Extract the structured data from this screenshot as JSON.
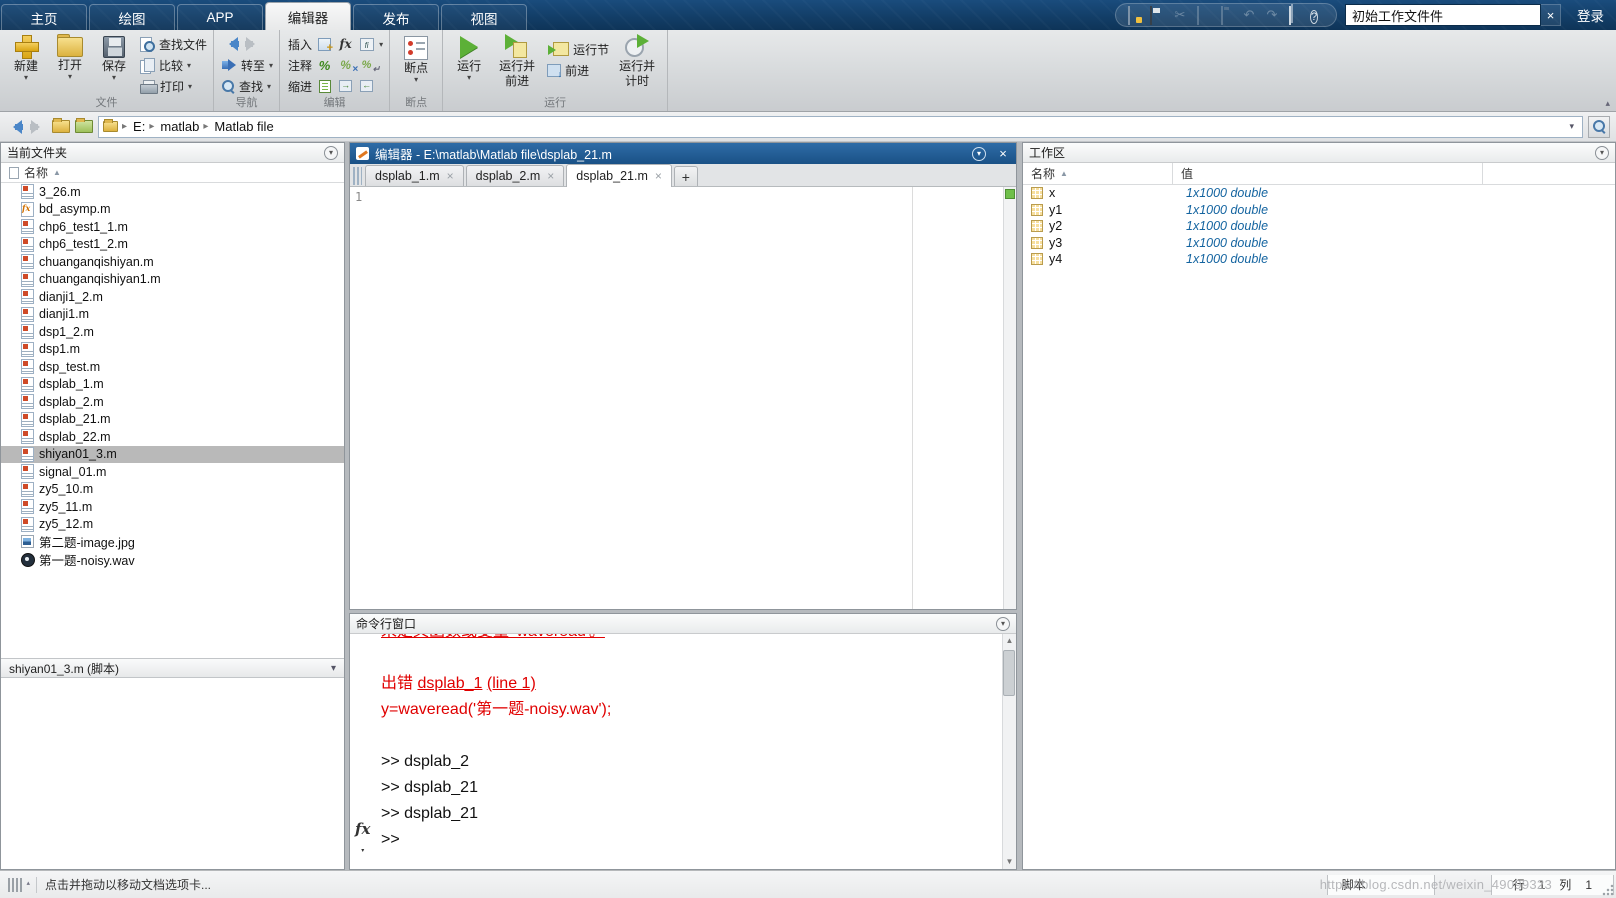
{
  "icons": {
    "dropdown": "▾",
    "sort_asc": "▲",
    "close": "×",
    "new_tab": "+",
    "scroll_up": "▲",
    "scroll_down": "▼",
    "undo": "↶",
    "redo": "↷",
    "cut": "✂",
    "help": "?",
    "collapse": "▴",
    "fx": "fx",
    "prompt": ">>"
  },
  "titlebar": {
    "tabs": [
      {
        "label": "主页"
      },
      {
        "label": "绘图"
      },
      {
        "label": "APP"
      },
      {
        "label": "编辑器",
        "active": true
      },
      {
        "label": "发布"
      },
      {
        "label": "视图"
      }
    ],
    "search_value": "初始工作文件件",
    "login_label": "登录"
  },
  "ribbon": {
    "file_group": {
      "label": "文件",
      "new": "新建",
      "open": "打开",
      "save": "保存",
      "find_files": "查找文件",
      "compare": "比较",
      "print": "打印"
    },
    "nav_group": {
      "label": "导航",
      "goto": "转至",
      "find": "查找"
    },
    "edit_group": {
      "label": "编辑",
      "insert": "插入",
      "comment": "注释",
      "indent": "缩进"
    },
    "bp_group": {
      "label": "断点",
      "breakpoints": "断点"
    },
    "run_group": {
      "label": "运行",
      "run": "运行",
      "run_advance_1": "运行并",
      "run_advance_2": "前进",
      "run_section": "运行节",
      "advance": "前进",
      "run_time_1": "运行并",
      "run_time_2": "计时"
    }
  },
  "address_bar": {
    "crumbs": [
      {
        "label": "E:"
      },
      {
        "label": "matlab"
      },
      {
        "label": "Matlab file"
      }
    ]
  },
  "current_folder": {
    "title": "当前文件夹",
    "name_header": "名称",
    "files": [
      {
        "name": "3_26.m",
        "type": "script"
      },
      {
        "name": "bd_asymp.m",
        "type": "function"
      },
      {
        "name": "chp6_test1_1.m",
        "type": "script"
      },
      {
        "name": "chp6_test1_2.m",
        "type": "script"
      },
      {
        "name": "chuanganqishiyan.m",
        "type": "script"
      },
      {
        "name": "chuanganqishiyan1.m",
        "type": "script"
      },
      {
        "name": "dianji1_2.m",
        "type": "script"
      },
      {
        "name": "dianji1.m",
        "type": "script"
      },
      {
        "name": "dsp1_2.m",
        "type": "script"
      },
      {
        "name": "dsp1.m",
        "type": "script"
      },
      {
        "name": "dsp_test.m",
        "type": "script"
      },
      {
        "name": "dsplab_1.m",
        "type": "script"
      },
      {
        "name": "dsplab_2.m",
        "type": "script"
      },
      {
        "name": "dsplab_21.m",
        "type": "script"
      },
      {
        "name": "dsplab_22.m",
        "type": "script"
      },
      {
        "name": "shiyan01_3.m",
        "type": "script",
        "selected": true
      },
      {
        "name": "signal_01.m",
        "type": "script"
      },
      {
        "name": "zy5_10.m",
        "type": "script"
      },
      {
        "name": "zy5_11.m",
        "type": "script"
      },
      {
        "name": "zy5_12.m",
        "type": "script"
      },
      {
        "name": "第二题-image.jpg",
        "type": "image"
      },
      {
        "name": "第一题-noisy.wav",
        "type": "audio"
      }
    ],
    "details": "shiyan01_3.m  (脚本)"
  },
  "editor": {
    "title": "编辑器 - E:\\matlab\\Matlab file\\dsplab_21.m",
    "tabs": [
      {
        "label": "dsplab_1.m"
      },
      {
        "label": "dsplab_2.m"
      },
      {
        "label": "dsplab_21.m",
        "active": true
      }
    ],
    "line_number": "1"
  },
  "command_window": {
    "title": "命令行窗口",
    "clipped_line": "未定义函数或变量 'waveread'。",
    "error_label": "出错 ",
    "error_file_link": "dsplab_1",
    "error_line_link": "(line 1)",
    "error_code": "y=waveread('第一题-noisy.wav');",
    "history": [
      {
        "line": ">> dsplab_2"
      },
      {
        "line": ">> dsplab_21"
      },
      {
        "line": ">> dsplab_21"
      }
    ],
    "prompt": ">>"
  },
  "workspace": {
    "title": "工作区",
    "name_header": "名称",
    "value_header": "值",
    "vars": [
      {
        "name": "x",
        "value": "1x1000 double"
      },
      {
        "name": "y1",
        "value": "1x1000 double"
      },
      {
        "name": "y2",
        "value": "1x1000 double"
      },
      {
        "name": "y3",
        "value": "1x1000 double"
      },
      {
        "name": "y4",
        "value": "1x1000 double"
      }
    ]
  },
  "status_bar": {
    "drag_hint": "点击并拖动以移动文档选项卡...",
    "file_type": "脚本",
    "line_label": "行",
    "line_value": "1",
    "col_label": "列",
    "col_value": "1",
    "watermark": "https://blog.csdn.net/weixin_49099323"
  }
}
